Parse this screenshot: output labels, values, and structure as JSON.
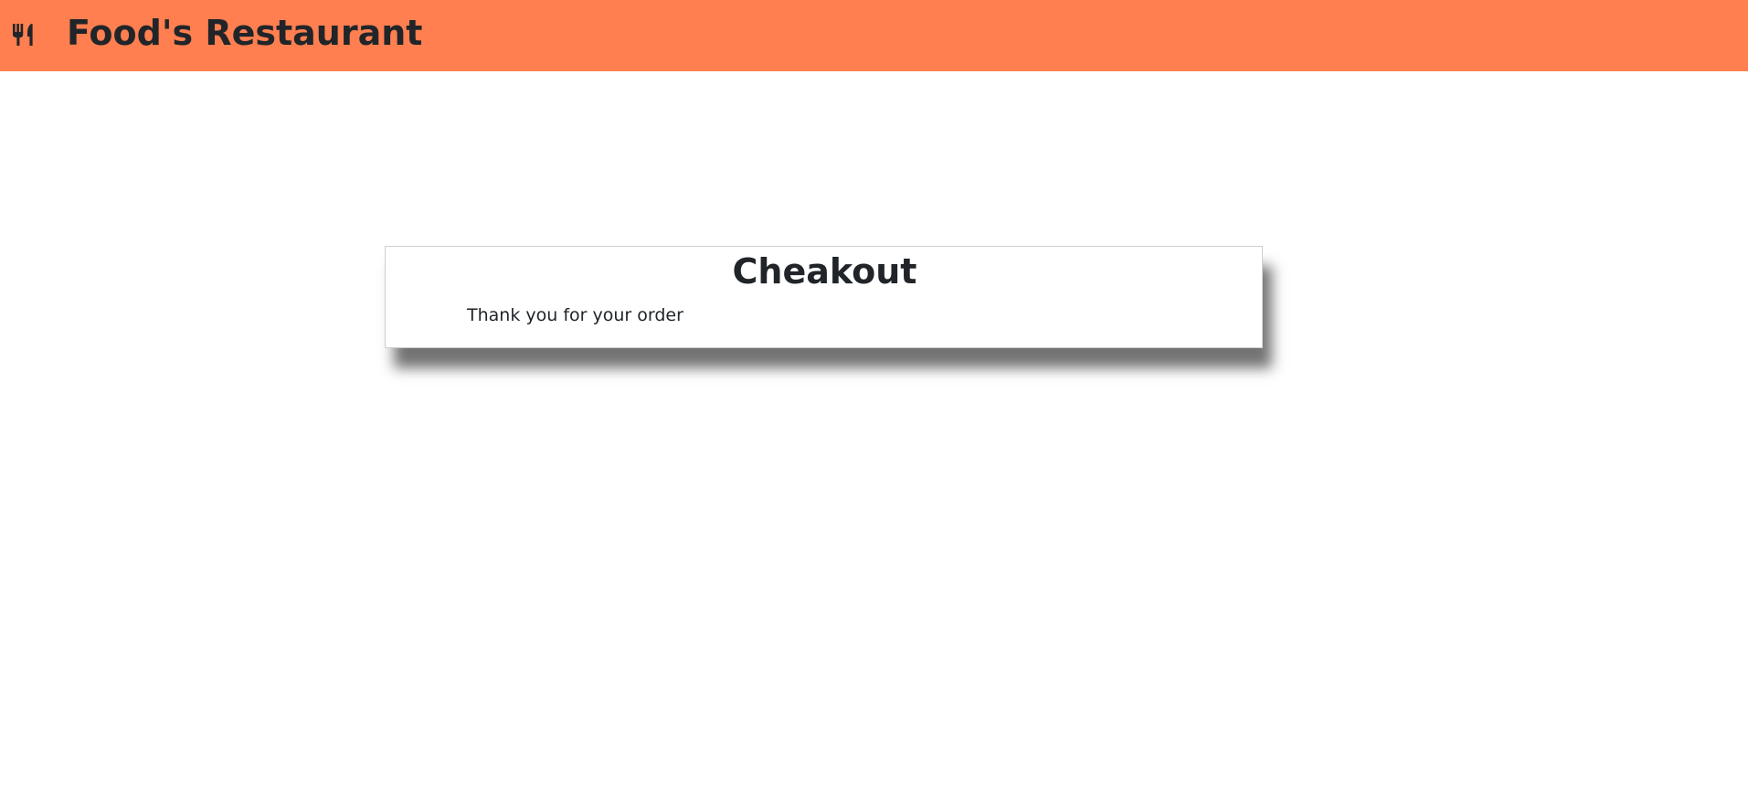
{
  "header": {
    "brand_icon": "fork-knife-icon",
    "brand_title": "Food's Restaurant",
    "background_color": "#ff7f50"
  },
  "main": {
    "card": {
      "title": "Cheakout",
      "message": "Thank you for your order"
    }
  }
}
